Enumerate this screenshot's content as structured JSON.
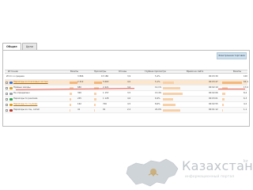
{
  "tabs": [
    {
      "label": "Общие"
    },
    {
      "label": "Цели"
    }
  ],
  "group_header": "Электронная торговля",
  "columns": {
    "name": "Источник",
    "c1": "Визиты",
    "c2": "Просмотры",
    "c3": "Отказы",
    "c4": "Глубина просмотра",
    "c5": "Время на сайте",
    "c6": "Визиты"
  },
  "total": {
    "label": "Итого и средние",
    "c1": "3 866",
    "c2": "15 186",
    "c3": "3,9",
    "c4": "5,4%",
    "c5": "00:03:30",
    "c6": "100"
  },
  "rows": [
    {
      "label": "Переходы из поисковых систем",
      "c1": "2 412",
      "c2": "5 663",
      "c3": "4,0",
      "c4": "5,1%",
      "c5": "00:03:47",
      "c6": "62,4",
      "icon_color": "#3b78d8"
    },
    {
      "label": "Прямые заходы",
      "c1": "680",
      "c2": "2 421",
      "c3": "3,6",
      "c4": "12,1%",
      "c5": "00:02:19",
      "c6": "17,6",
      "icon_color": "#e0a020"
    },
    {
      "label": "Не определено",
      "c1": "326",
      "c2": "1 157",
      "c3": "3,5",
      "c4": "13,4%",
      "c5": "00:02:06",
      "c6": "8,4",
      "icon_color": "#9aa0a6"
    },
    {
      "label": "Переходы по рекламе",
      "c1": "245",
      "c2": "1 128",
      "c3": "4,6",
      "c4": "6,9%",
      "c5": "00:03:01",
      "c6": "6,3",
      "icon_color": "#34a853"
    },
    {
      "label": "Переходы по ссылкам",
      "c1": "162",
      "c2": "726",
      "c3": "4,5",
      "c4": "8,6%",
      "c5": "00:02:55",
      "c6": "4,2",
      "icon_color": "#e0a020"
    },
    {
      "label": "Переходы из соц. сетей",
      "c1": "41",
      "c2": "91",
      "c3": "2,2",
      "c4": "22,0%",
      "c5": "00:01:12",
      "c6": "1,1",
      "icon_color": "#c0392b"
    }
  ],
  "logo": {
    "brand": "Казахстан",
    "suffix": "kz",
    "tagline": "информационный портал"
  },
  "colors": {
    "bar": "#f4b87a",
    "selected_row": "#fbe7d0",
    "rule": "#e35b4a",
    "map_fill": "#cfd4d8",
    "map_accent": "#c9a86a"
  }
}
